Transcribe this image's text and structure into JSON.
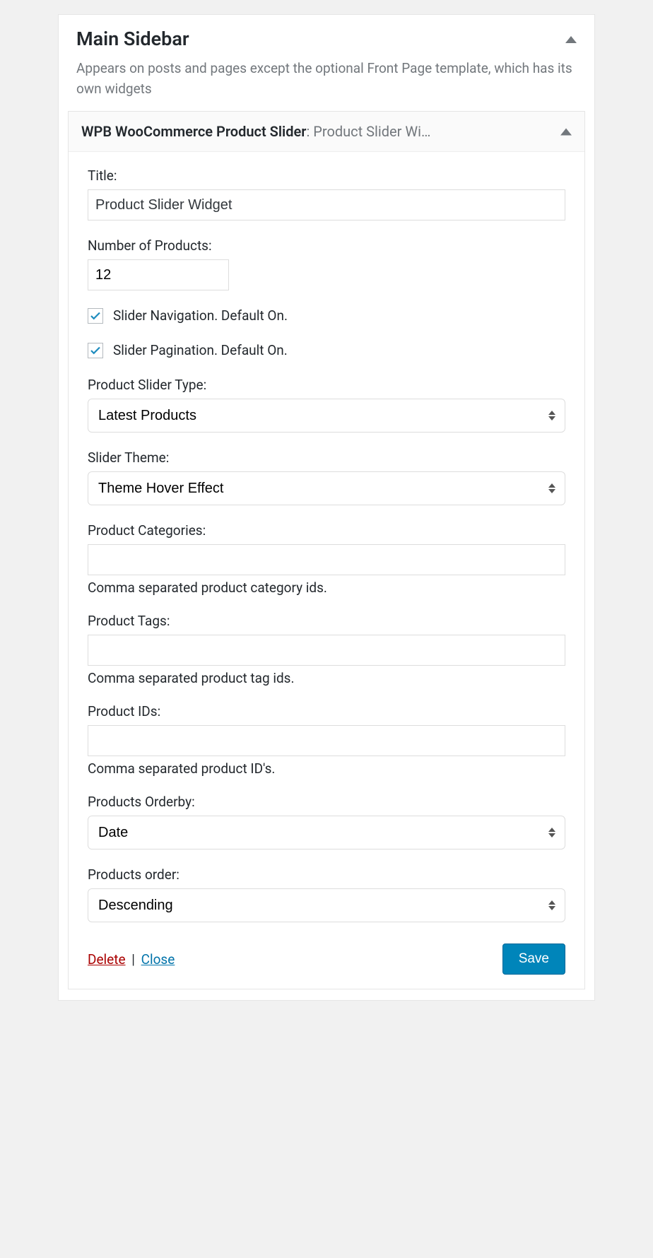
{
  "area": {
    "title": "Main Sidebar",
    "description": "Appears on posts and pages except the optional Front Page template, which has its own widgets"
  },
  "widget": {
    "name": "WPB WooCommerce Product Slider",
    "subtitle": ": Product Slider Wi…",
    "fields": {
      "title": {
        "label": "Title:",
        "value": "Product Slider Widget"
      },
      "count": {
        "label": "Number of Products:",
        "value": "12"
      },
      "nav": {
        "label": "Slider Navigation. Default On.",
        "checked": true
      },
      "pag": {
        "label": "Slider Pagination. Default On.",
        "checked": true
      },
      "type": {
        "label": "Product Slider Type:",
        "value": "Latest Products"
      },
      "theme": {
        "label": "Slider Theme:",
        "value": "Theme Hover Effect"
      },
      "cats": {
        "label": "Product Categories:",
        "value": "",
        "help": "Comma separated product category ids."
      },
      "tags": {
        "label": "Product Tags:",
        "value": "",
        "help": "Comma separated product tag ids."
      },
      "ids": {
        "label": "Product IDs:",
        "value": "",
        "help": "Comma separated product ID's."
      },
      "orderby": {
        "label": "Products Orderby:",
        "value": "Date"
      },
      "order": {
        "label": "Products order:",
        "value": "Descending"
      }
    },
    "actions": {
      "delete": "Delete",
      "close": "Close",
      "save": "Save"
    }
  }
}
